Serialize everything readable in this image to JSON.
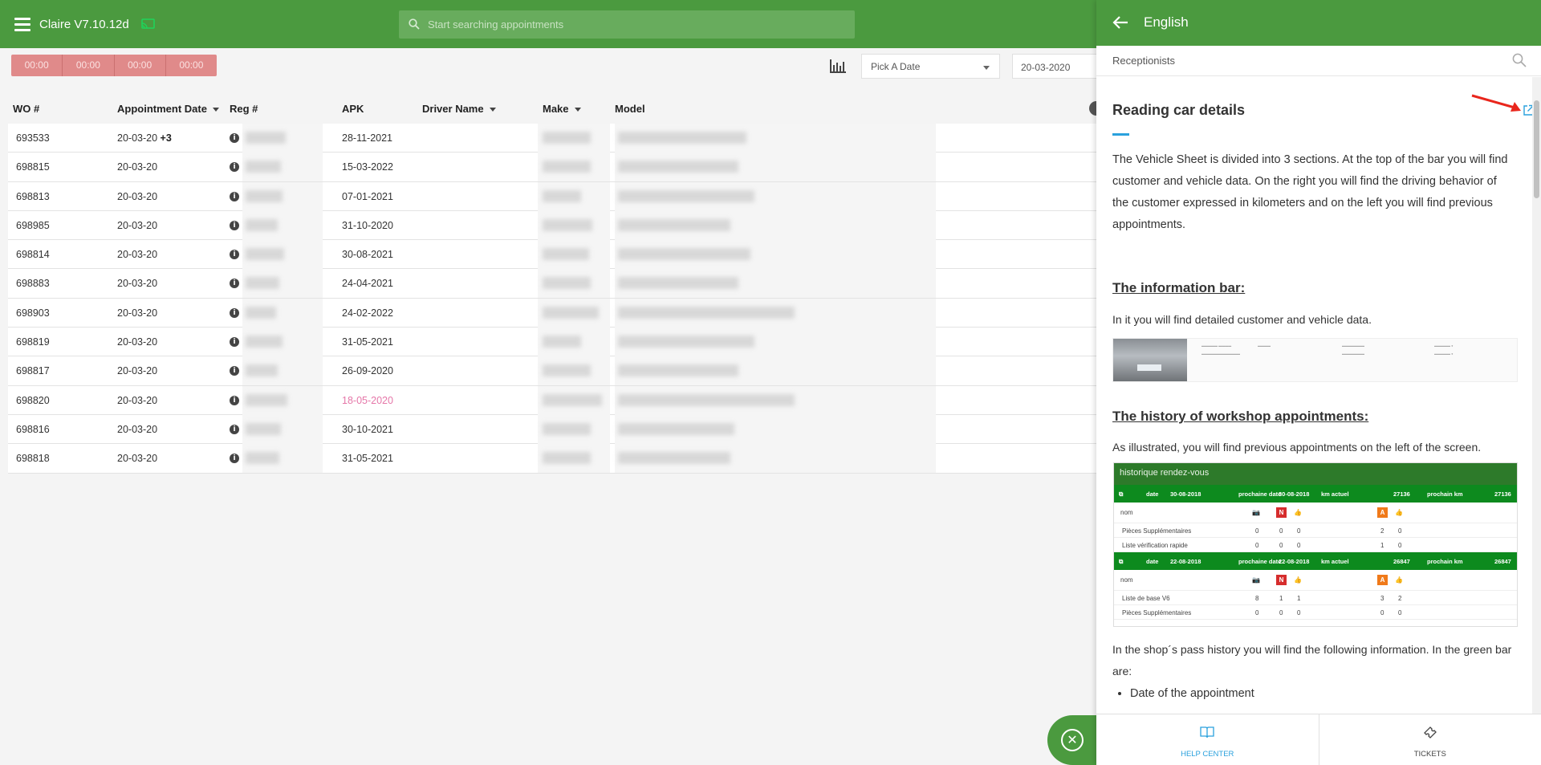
{
  "app": {
    "title": "Claire V7.10.12d"
  },
  "search": {
    "placeholder": "Start searching appointments"
  },
  "timers": [
    "00:00",
    "00:00",
    "00:00",
    "00:00"
  ],
  "filters": {
    "date_picker_label": "Pick A Date",
    "date_value": "20-03-2020"
  },
  "table": {
    "columns": [
      "WO #",
      "Appointment Date",
      "Reg #",
      "APK",
      "Driver Name",
      "Make",
      "Model"
    ],
    "rows": [
      {
        "wo": "693533",
        "date": "20-03-20",
        "extra": "+3",
        "apk": "28-11-2021",
        "apk_overdue": false
      },
      {
        "wo": "698815",
        "date": "20-03-20",
        "extra": "",
        "apk": "15-03-2022",
        "apk_overdue": false
      },
      {
        "wo": "698813",
        "date": "20-03-20",
        "extra": "",
        "apk": "07-01-2021",
        "apk_overdue": false
      },
      {
        "wo": "698985",
        "date": "20-03-20",
        "extra": "",
        "apk": "31-10-2020",
        "apk_overdue": false
      },
      {
        "wo": "698814",
        "date": "20-03-20",
        "extra": "",
        "apk": "30-08-2021",
        "apk_overdue": false
      },
      {
        "wo": "698883",
        "date": "20-03-20",
        "extra": "",
        "apk": "24-04-2021",
        "apk_overdue": false
      },
      {
        "wo": "698903",
        "date": "20-03-20",
        "extra": "",
        "apk": "24-02-2022",
        "apk_overdue": false
      },
      {
        "wo": "698819",
        "date": "20-03-20",
        "extra": "",
        "apk": "31-05-2021",
        "apk_overdue": false
      },
      {
        "wo": "698817",
        "date": "20-03-20",
        "extra": "",
        "apk": "26-09-2020",
        "apk_overdue": false
      },
      {
        "wo": "698820",
        "date": "20-03-20",
        "extra": "",
        "apk": "18-05-2020",
        "apk_overdue": true
      },
      {
        "wo": "698816",
        "date": "20-03-20",
        "extra": "",
        "apk": "30-10-2021",
        "apk_overdue": false
      },
      {
        "wo": "698818",
        "date": "20-03-20",
        "extra": "",
        "apk": "31-05-2021",
        "apk_overdue": false
      }
    ]
  },
  "help_panel": {
    "language": "English",
    "category": "Receptionists",
    "article_title": "Reading car details",
    "intro": "The Vehicle Sheet is divided into 3 sections. At the top of the bar you will find customer and vehicle data. On the right you will find the driving behavior of the customer expressed in kilometers and on the left you will find previous appointments.",
    "section1_title": "The information bar:",
    "section1_text": "In it you will find detailed customer and vehicle data.",
    "section2_title": "The history of workshop appointments:",
    "section2_text": "As illustrated, you will find previous appointments on the left of the screen.",
    "history": {
      "title": "historique rendez-vous",
      "blocks": [
        {
          "date": "30-08-2018",
          "next_date": "30-08-2018",
          "km": "27136",
          "next_km": "27136",
          "rows": [
            {
              "label": "Pièces Supplémentaires",
              "v": [
                "0",
                "0",
                "0",
                "2",
                "0"
              ]
            },
            {
              "label": "Liste vérification rapide",
              "v": [
                "0",
                "0",
                "0",
                "1",
                "0"
              ]
            }
          ]
        },
        {
          "date": "22-08-2018",
          "next_date": "22-08-2018",
          "km": "26847",
          "next_km": "26847",
          "rows": [
            {
              "label": "Liste de base V6",
              "v": [
                "8",
                "1",
                "1",
                "3",
                "2"
              ]
            },
            {
              "label": "Pièces Supplémentaires",
              "v": [
                "0",
                "0",
                "0",
                "0",
                "0"
              ]
            }
          ]
        }
      ],
      "labels": {
        "date": "date",
        "next_date": "prochaine date",
        "km": "km actuel",
        "next_km": "prochain km",
        "name": "nom",
        "n": "N",
        "a": "A"
      }
    },
    "para3": "In the shop´s pass history you will find the following information. In the green bar are:",
    "bullets": [
      "Date of the appointment"
    ],
    "footer": {
      "help_center": "HELP CENTER",
      "tickets": "TICKETS"
    }
  },
  "colors": {
    "primary": "#4b9a3f",
    "accent": "#2aa1dd",
    "overdue": "#e576a8",
    "timer": "#e08a8a"
  }
}
